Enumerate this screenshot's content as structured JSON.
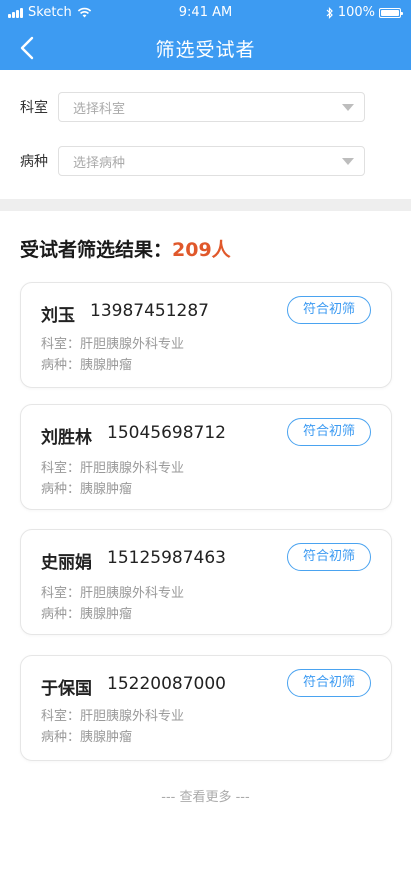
{
  "status_bar": {
    "carrier": "Sketch",
    "time": "9:41 AM",
    "battery": "100%"
  },
  "navbar": {
    "title": "筛选受试者"
  },
  "filters": [
    {
      "label": "科室",
      "placeholder": "选择科室"
    },
    {
      "label": "病种",
      "placeholder": "选择病种"
    }
  ],
  "result": {
    "prefix": "受试者筛选结果：",
    "count": "209人"
  },
  "cards": [
    {
      "name": "刘玉",
      "phone": "13987451287",
      "dept": "科室：肝胆胰腺外科专业",
      "disease": "病种：胰腺肿瘤",
      "badge": "符合初筛"
    },
    {
      "name": "刘胜林",
      "phone": "15045698712",
      "dept": "科室：肝胆胰腺外科专业",
      "disease": "病种：胰腺肿瘤",
      "badge": "符合初筛"
    },
    {
      "name": "史丽娟",
      "phone": "15125987463",
      "dept": "科室：肝胆胰腺外科专业",
      "disease": "病种：胰腺肿瘤",
      "badge": "符合初筛"
    },
    {
      "name": "于保国",
      "phone": "15220087000",
      "dept": "科室：肝胆胰腺外科专业",
      "disease": "病种：胰腺肿瘤",
      "badge": "符合初筛"
    }
  ],
  "footer": {
    "more": "--- 查看更多 ---"
  },
  "colors": {
    "brand_blue": "#3d9bf2",
    "accent_orange": "#e0582b"
  }
}
